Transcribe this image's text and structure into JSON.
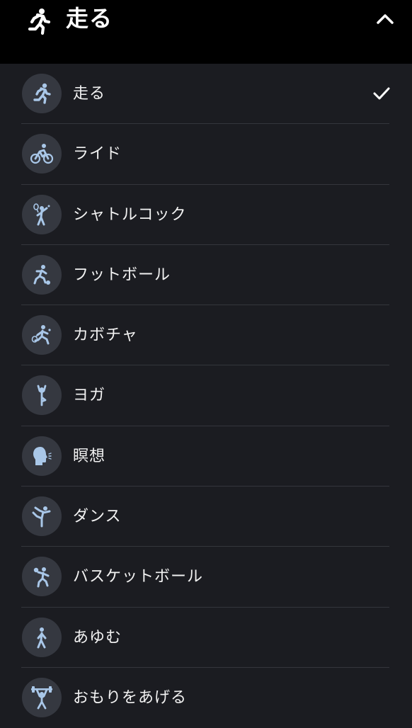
{
  "header": {
    "title": "走る",
    "icon": "running-icon",
    "collapse_icon": "chevron-up-icon"
  },
  "colors": {
    "header_bg": "#000000",
    "list_bg": "#1b1c21",
    "icon_circle": "#353840",
    "icon_figure": "#a9c7e8",
    "divider": "#34363c"
  },
  "items": [
    {
      "label": "走る",
      "icon": "running-icon",
      "selected": true
    },
    {
      "label": "ライド",
      "icon": "cycling-icon",
      "selected": false
    },
    {
      "label": "シャトルコック",
      "icon": "badminton-icon",
      "selected": false
    },
    {
      "label": "フットボール",
      "icon": "football-icon",
      "selected": false
    },
    {
      "label": "カボチャ",
      "icon": "tennis-icon",
      "selected": false
    },
    {
      "label": "ヨガ",
      "icon": "yoga-icon",
      "selected": false
    },
    {
      "label": "瞑想",
      "icon": "meditation-icon",
      "selected": false
    },
    {
      "label": "ダンス",
      "icon": "dance-icon",
      "selected": false
    },
    {
      "label": "バスケットボール",
      "icon": "basketball-icon",
      "selected": false
    },
    {
      "label": "あゆむ",
      "icon": "walking-icon",
      "selected": false
    },
    {
      "label": "おもりをあげる",
      "icon": "weightlifting-icon",
      "selected": false
    }
  ]
}
